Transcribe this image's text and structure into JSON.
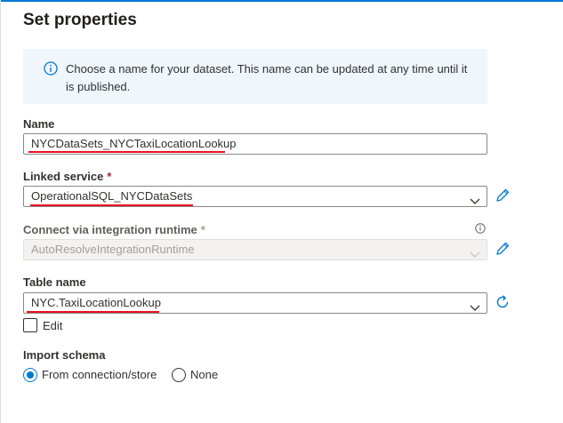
{
  "panel": {
    "title": "Set properties",
    "info_text": "Choose a name for your dataset. This name can be updated at any time until it is published."
  },
  "name_field": {
    "label": "Name",
    "value": "NYCDataSets_NYCTaxiLocationLookup"
  },
  "linked_service": {
    "label": "Linked service",
    "required_mark": "*",
    "value": "OperationalSQL_NYCDataSets",
    "side_icon": "pencil-icon"
  },
  "integration_runtime": {
    "label": "Connect via integration runtime",
    "required_mark": "*",
    "value": "AutoResolveIntegrationRuntime",
    "disabled": true,
    "side_icon": "pencil-icon"
  },
  "table_name": {
    "label": "Table name",
    "value": "NYC.TaxiLocationLookup",
    "side_icon": "refresh-icon"
  },
  "edit_checkbox": {
    "label": "Edit",
    "checked": false
  },
  "import_schema": {
    "label": "Import schema",
    "options": [
      {
        "label": "From connection/store",
        "selected": true
      },
      {
        "label": "None",
        "selected": false
      }
    ]
  },
  "colors": {
    "accent": "#0078d4",
    "info_background": "#eff6fc",
    "required": "#a4262c",
    "annotation_red": "#e81123"
  }
}
